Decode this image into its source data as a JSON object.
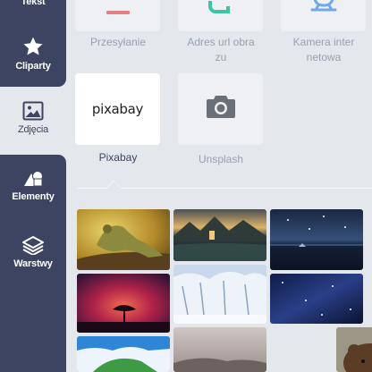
{
  "sidebar": {
    "items": [
      {
        "label": "Tekst",
        "icon": "text-icon"
      },
      {
        "label": "Cliparty",
        "icon": "star-icon"
      },
      {
        "label": "Zdjęcia",
        "icon": "image-icon"
      },
      {
        "label": "Elementy",
        "icon": "shapes-icon"
      },
      {
        "label": "Warstwy",
        "icon": "layers-icon"
      }
    ]
  },
  "sources": [
    {
      "label": "Przesyłanie",
      "icon": "upload-icon"
    },
    {
      "label": "Adres url obrazu",
      "label_line1": "Adres url obra",
      "label_line2": "zu",
      "icon": "link-icon"
    },
    {
      "label": "Kamera internetowa",
      "label_line1": "Kamera inter",
      "label_line2": "netowa",
      "icon": "webcam-icon"
    },
    {
      "label": "Pixabay",
      "logo_text": "pixabay",
      "selected": true
    },
    {
      "label": "Unsplash",
      "icon": "camera-icon"
    }
  ],
  "colors": {
    "sidebar_dark": "#3d4461",
    "panel_bg": "#e4e7ec",
    "tile_bg": "#eef0f3",
    "muted_text": "#9aa0ad"
  },
  "gallery": [
    {
      "subject": "iguana on branch",
      "icon": "photo-thumbnail"
    },
    {
      "subject": "mountain lake at dusk",
      "icon": "photo-thumbnail"
    },
    {
      "subject": "night sky over water",
      "icon": "photo-thumbnail"
    },
    {
      "subject": "tree under red sky",
      "icon": "photo-thumbnail"
    },
    {
      "subject": "snowy trees",
      "icon": "photo-thumbnail"
    },
    {
      "subject": "starry blue night",
      "icon": "photo-thumbnail"
    },
    {
      "subject": "island with blue sky",
      "icon": "photo-thumbnail"
    },
    {
      "subject": "misty hills",
      "icon": "photo-thumbnail"
    },
    {
      "subject": "brown bear",
      "icon": "photo-thumbnail"
    }
  ]
}
